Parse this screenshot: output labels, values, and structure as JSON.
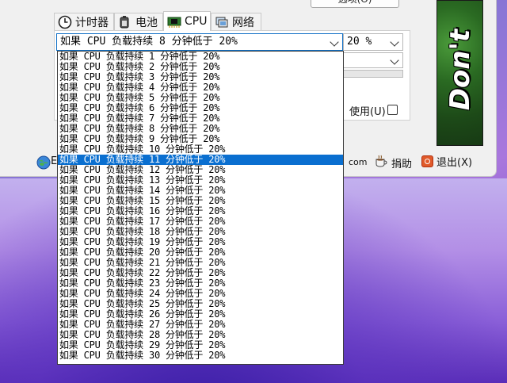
{
  "window": {
    "top_button_label": "选项(O)",
    "tabs": [
      {
        "label": "计时器",
        "icon": "clock-icon"
      },
      {
        "label": "电池",
        "icon": "battery-icon"
      },
      {
        "label": "CPU",
        "icon": "chip-icon",
        "active": true
      },
      {
        "label": "网络",
        "icon": "network-icon"
      }
    ],
    "cpu_condition_selected": "如果 CPU 负载持续 8 分钟低于 20%",
    "percent_select_value": "20 %",
    "second_select_value": "",
    "progress_fraction": 0.0,
    "use_label": "使用(U)",
    "use_checked": false,
    "banner_text": "Don't",
    "bottom": {
      "left_letter": "E",
      "com_text": "com",
      "donate_label": "捐助",
      "exit_label": "退出(X)"
    }
  },
  "dropdown": {
    "selected_index": 10,
    "items": [
      "如果 CPU 负载持续 1 分钟低于 20%",
      "如果 CPU 负载持续 2 分钟低于 20%",
      "如果 CPU 负载持续 3 分钟低于 20%",
      "如果 CPU 负载持续 4 分钟低于 20%",
      "如果 CPU 负载持续 5 分钟低于 20%",
      "如果 CPU 负载持续 6 分钟低于 20%",
      "如果 CPU 负载持续 7 分钟低于 20%",
      "如果 CPU 负载持续 8 分钟低于 20%",
      "如果 CPU 负载持续 9 分钟低于 20%",
      "如果 CPU 负载持续 10 分钟低于 20%",
      "如果 CPU 负载持续 11 分钟低于 20%",
      "如果 CPU 负载持续 12 分钟低于 20%",
      "如果 CPU 负载持续 13 分钟低于 20%",
      "如果 CPU 负载持续 14 分钟低于 20%",
      "如果 CPU 负载持续 15 分钟低于 20%",
      "如果 CPU 负载持续 16 分钟低于 20%",
      "如果 CPU 负载持续 17 分钟低于 20%",
      "如果 CPU 负载持续 18 分钟低于 20%",
      "如果 CPU 负载持续 19 分钟低于 20%",
      "如果 CPU 负载持续 20 分钟低于 20%",
      "如果 CPU 负载持续 21 分钟低于 20%",
      "如果 CPU 负载持续 22 分钟低于 20%",
      "如果 CPU 负载持续 23 分钟低于 20%",
      "如果 CPU 负载持续 24 分钟低于 20%",
      "如果 CPU 负载持续 25 分钟低于 20%",
      "如果 CPU 负载持续 26 分钟低于 20%",
      "如果 CPU 负载持续 27 分钟低于 20%",
      "如果 CPU 负载持续 28 分钟低于 20%",
      "如果 CPU 负载持续 29 分钟低于 20%",
      "如果 CPU 负载持续 30 分钟低于 20%"
    ]
  },
  "colors": {
    "selection": "#0a6fd0",
    "focus_border": "#0f6fc6"
  }
}
